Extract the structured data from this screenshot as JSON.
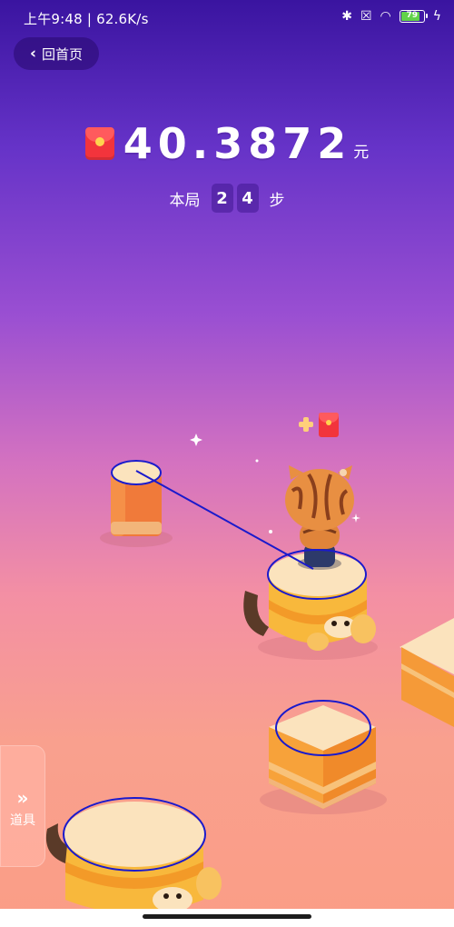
{
  "status_bar": {
    "left_text": "上午9:48 | 62.6K/s",
    "battery": "79",
    "icons": [
      "bluetooth-icon",
      "no-sim-icon",
      "wifi-icon",
      "battery-icon",
      "charging-icon"
    ]
  },
  "nav": {
    "back_label": "回首页"
  },
  "score": {
    "value": "40.3872",
    "unit": "元"
  },
  "steps": {
    "prefix": "本局",
    "digits": [
      "2",
      "4"
    ],
    "suffix": "步"
  },
  "side_panel": {
    "items_label": "道具"
  },
  "colors": {
    "envelope_red": "#f2343c",
    "annotation_blue": "#1a1acc",
    "platform_top": "#f9dcb0",
    "platform_orange": "#f7a93a"
  }
}
